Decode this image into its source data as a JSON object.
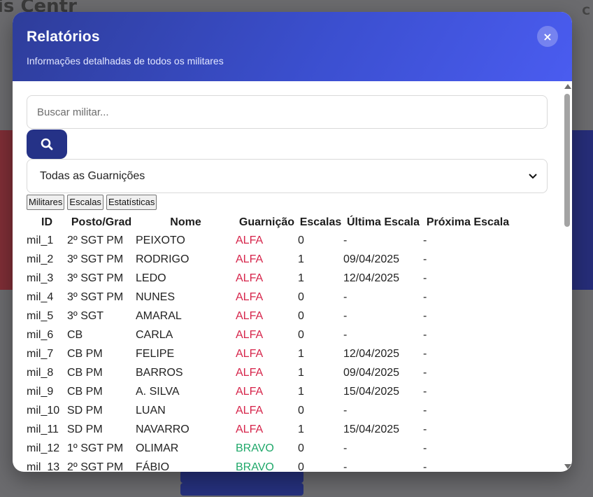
{
  "background": {
    "title_fragment": "is Centr",
    "right_fragment": "C"
  },
  "modal": {
    "title": "Relatórios",
    "subtitle": "Informações detalhadas de todos os militares",
    "close_label": "×",
    "search": {
      "placeholder": "Buscar militar...",
      "value": ""
    },
    "search_button_icon": "search-icon",
    "filter": {
      "selected": "Todas as Guarnições"
    },
    "tabs": [
      "Militares",
      "Escalas",
      "Estatísticas"
    ],
    "table": {
      "headers": [
        "ID",
        "Posto/Grad",
        "Nome",
        "Guarnição",
        "Escalas",
        "Última Escala",
        "Próxima Escala"
      ],
      "rows": [
        [
          "mil_1",
          "2º SGT PM",
          "PEIXOTO",
          "ALFA",
          "0",
          "-",
          "-"
        ],
        [
          "mil_2",
          "3º SGT PM",
          "RODRIGO",
          "ALFA",
          "1",
          "09/04/2025",
          "-"
        ],
        [
          "mil_3",
          "3º SGT PM",
          "LEDO",
          "ALFA",
          "1",
          "12/04/2025",
          "-"
        ],
        [
          "mil_4",
          "3º SGT PM",
          "NUNES",
          "ALFA",
          "0",
          "-",
          "-"
        ],
        [
          "mil_5",
          "3º SGT",
          "AMARAL",
          "ALFA",
          "0",
          "-",
          "-"
        ],
        [
          "mil_6",
          "CB",
          "CARLA",
          "ALFA",
          "0",
          "-",
          "-"
        ],
        [
          "mil_7",
          "CB PM",
          "FELIPE",
          "ALFA",
          "1",
          "12/04/2025",
          "-"
        ],
        [
          "mil_8",
          "CB PM",
          "BARROS",
          "ALFA",
          "1",
          "09/04/2025",
          "-"
        ],
        [
          "mil_9",
          "CB PM",
          "A. SILVA",
          "ALFA",
          "1",
          "15/04/2025",
          "-"
        ],
        [
          "mil_10",
          "SD PM",
          "LUAN",
          "ALFA",
          "0",
          "-",
          "-"
        ],
        [
          "mil_11",
          "SD PM",
          "NAVARRO",
          "ALFA",
          "1",
          "15/04/2025",
          "-"
        ],
        [
          "mil_12",
          "1º SGT PM",
          "OLIMAR",
          "BRAVO",
          "0",
          "-",
          "-"
        ],
        [
          "mil_13",
          "2º SGT PM",
          "FÁBIO",
          "BRAVO",
          "0",
          "-",
          "-"
        ]
      ]
    }
  },
  "colors": {
    "header_start": "#2e3d9a",
    "header_end": "#4a5cf0",
    "alfa": "#d6244a",
    "bravo": "#1fa86a",
    "button": "#253287"
  }
}
